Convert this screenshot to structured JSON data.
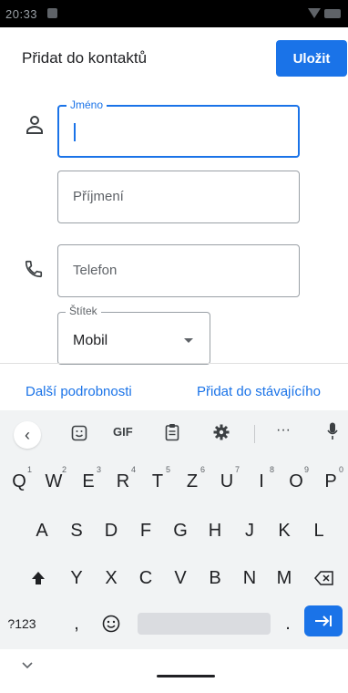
{
  "status_bar": {
    "time": "20:33"
  },
  "app_bar": {
    "title": "Přidat do kontaktů",
    "save_label": "Uložit"
  },
  "form": {
    "first_name": {
      "label": "Jméno",
      "value": ""
    },
    "last_name": {
      "placeholder": "Příjmení"
    },
    "phone": {
      "placeholder": "Telefon"
    },
    "label_select": {
      "label": "Štítek",
      "value": "Mobil"
    }
  },
  "actions": {
    "more_details": "Další podrobnosti",
    "add_existing": "Přidat do stávajícího"
  },
  "keyboard": {
    "toolbar": {
      "gif": "GIF",
      "more": "···"
    },
    "row1": [
      {
        "k": "Q",
        "h": "1"
      },
      {
        "k": "W",
        "h": "2"
      },
      {
        "k": "E",
        "h": "3"
      },
      {
        "k": "R",
        "h": "4"
      },
      {
        "k": "T",
        "h": "5"
      },
      {
        "k": "Z",
        "h": "6"
      },
      {
        "k": "U",
        "h": "7"
      },
      {
        "k": "I",
        "h": "8"
      },
      {
        "k": "O",
        "h": "9"
      },
      {
        "k": "P",
        "h": "0"
      }
    ],
    "row2": [
      "A",
      "S",
      "D",
      "F",
      "G",
      "H",
      "J",
      "K",
      "L"
    ],
    "row3": [
      "Y",
      "X",
      "C",
      "V",
      "B",
      "N",
      "M"
    ],
    "symbols": "?123",
    "comma": ",",
    "period": "."
  },
  "colors": {
    "accent": "#1a73e8",
    "keyboard_bg": "#f1f3f4"
  }
}
